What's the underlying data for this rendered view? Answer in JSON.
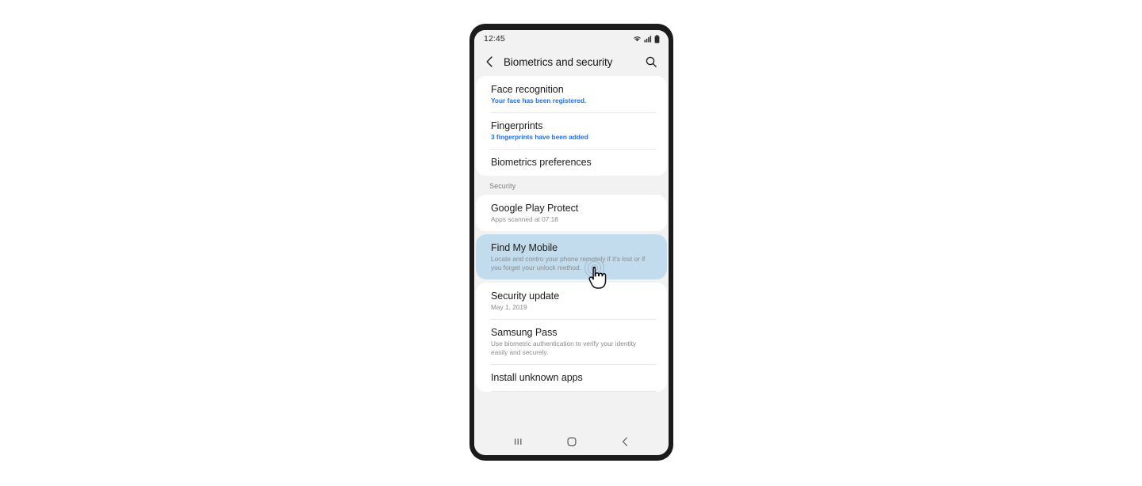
{
  "status_bar": {
    "time": "12:45",
    "icons": [
      "wifi-icon",
      "cellular-signal-icon",
      "battery-icon"
    ]
  },
  "app_bar": {
    "back_icon": "chevron-left-icon",
    "title": "Biometrics and security",
    "search_icon": "search-icon"
  },
  "groups": [
    {
      "section_label": null,
      "rows": [
        {
          "title": "Face recognition",
          "subtitle": "Your face has been registered.",
          "subtitle_style": "blue",
          "highlighted": false
        },
        {
          "title": "Fingerprints",
          "subtitle": "3 fingerprints have been added",
          "subtitle_style": "blue",
          "highlighted": false
        },
        {
          "title": "Biometrics preferences",
          "subtitle": null,
          "subtitle_style": "none",
          "highlighted": false
        }
      ]
    },
    {
      "section_label": "Security",
      "rows": [
        {
          "title": "Google Play Protect",
          "subtitle": "Apps scanned at 07:18",
          "subtitle_style": "gray",
          "highlighted": false
        }
      ]
    },
    {
      "section_label": null,
      "rows": [
        {
          "title": "Find My Mobile",
          "subtitle": "Locate and contro your phone remotely if it's lost or if you forget your unlock method.",
          "subtitle_style": "gray",
          "highlighted": true
        }
      ]
    },
    {
      "section_label": null,
      "rows": [
        {
          "title": "Security update",
          "subtitle": "May 1, 2019",
          "subtitle_style": "gray",
          "highlighted": false
        },
        {
          "title": "Samsung Pass",
          "subtitle": "Use biometric authentication to verify your identity easily and securely.",
          "subtitle_style": "gray",
          "highlighted": false
        },
        {
          "title": "Install unknown apps",
          "subtitle": null,
          "subtitle_style": "none",
          "highlighted": false
        }
      ]
    }
  ],
  "nav_bar": {
    "recents_icon": "recents-icon",
    "home_icon": "home-icon",
    "back_icon": "back-icon"
  },
  "cursor": {
    "type": "pointing-hand-cursor",
    "tap_ripple": "tap-ripple-indicator",
    "target_row": "Find My Mobile"
  },
  "colors": {
    "highlight_row": "#c3dced",
    "link_blue": "#1a73e8",
    "screen_bg": "#f2f2f2",
    "card_bg": "#ffffff",
    "frame": "#1b1b1b"
  }
}
